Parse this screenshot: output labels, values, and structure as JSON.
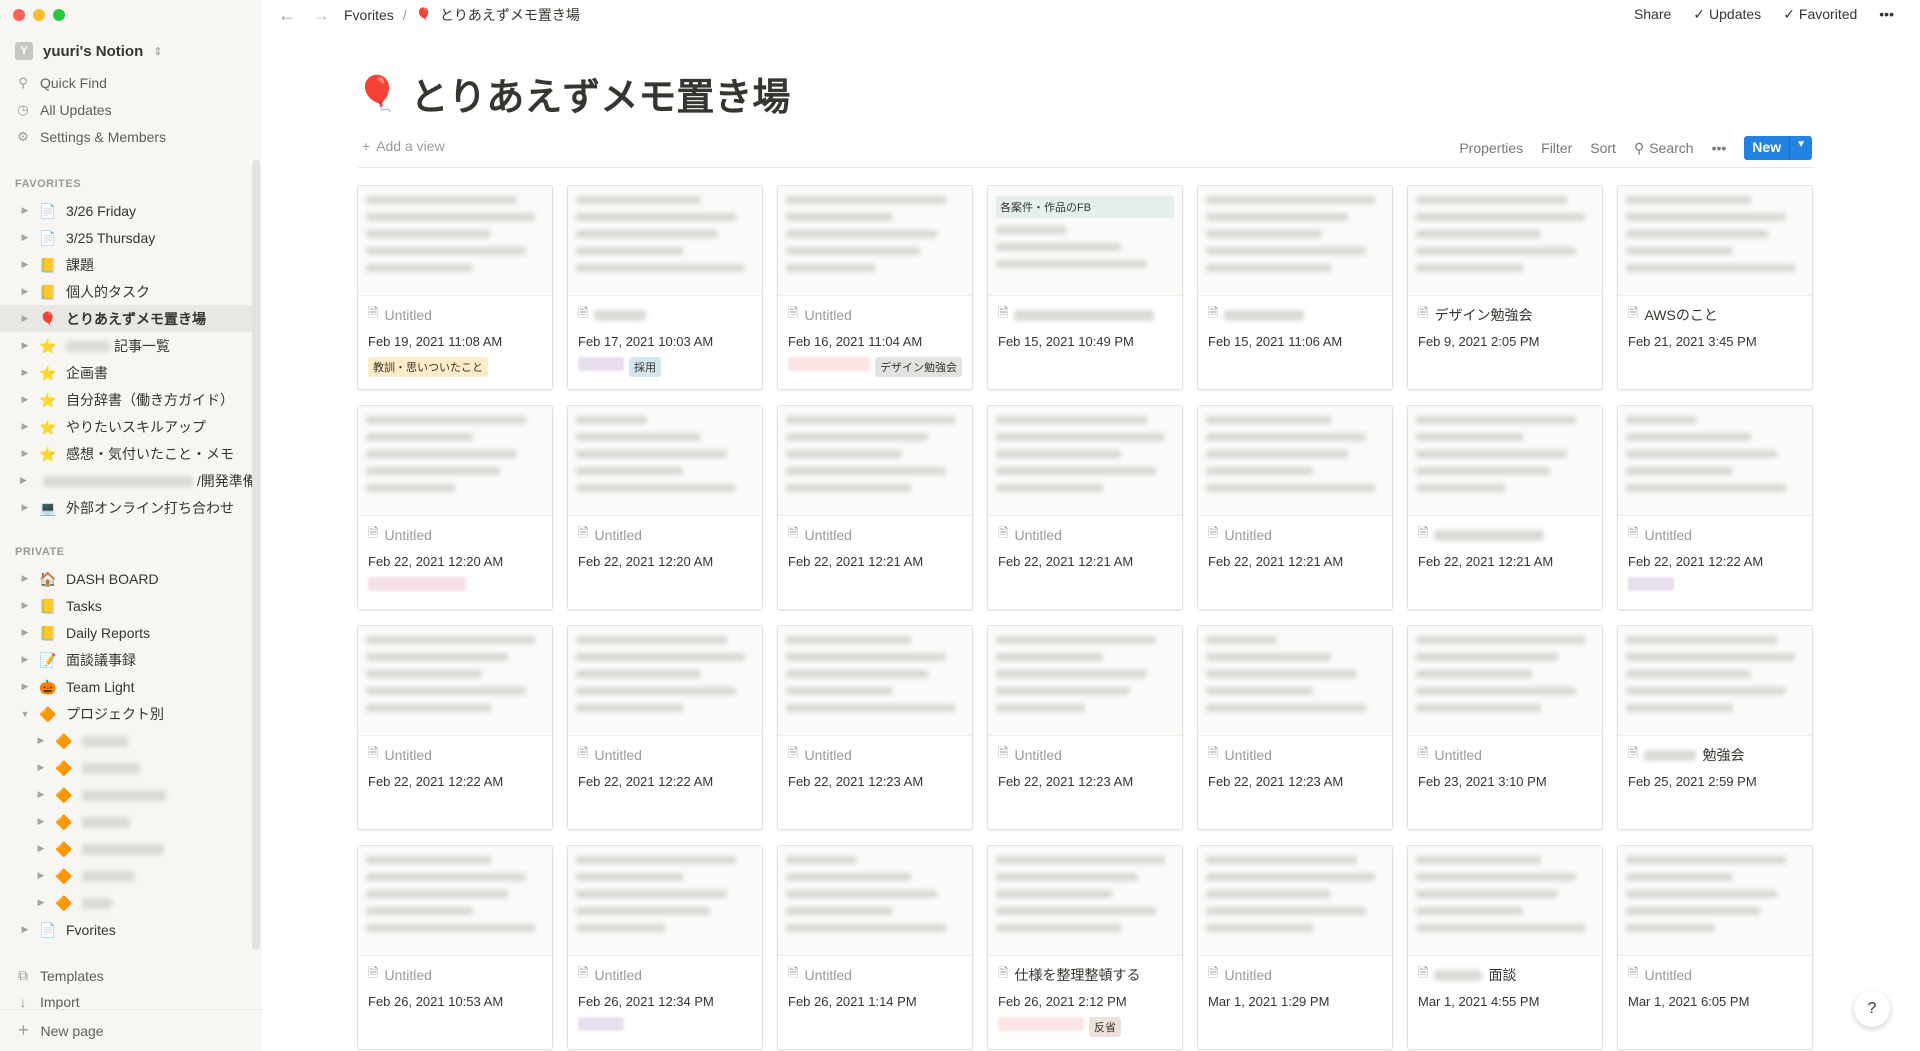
{
  "workspace": {
    "name": "yuuri's Notion",
    "avatar": "Y"
  },
  "nav": {
    "quick_find": "Quick Find",
    "all_updates": "All Updates",
    "settings": "Settings & Members"
  },
  "sidebar": {
    "favorites_label": "FAVORITES",
    "favorites": [
      {
        "icon": "📄",
        "label": "3/26 Friday"
      },
      {
        "icon": "📄",
        "label": "3/25 Thursday"
      },
      {
        "icon": "📒",
        "label": "課題"
      },
      {
        "icon": "📒",
        "label": "個人的タスク"
      },
      {
        "icon": "🎈",
        "label": "とりあえずメモ置き場"
      },
      {
        "icon": "⭐",
        "label": "記事一覧"
      },
      {
        "icon": "⭐",
        "label": "企画書"
      },
      {
        "icon": "⭐",
        "label": "自分辞書（働き方ガイド）"
      },
      {
        "icon": "⭐",
        "label": "やりたいスキルアップ"
      },
      {
        "icon": "⭐",
        "label": "感想・気付いたこと・メモ"
      },
      {
        "icon": "",
        "label": "/開発準備"
      },
      {
        "icon": "💻",
        "label": "外部オンライン打ち合わせ"
      }
    ],
    "private_label": "PRIVATE",
    "private": [
      {
        "icon": "🏠",
        "label": "DASH BOARD"
      },
      {
        "icon": "📒",
        "label": "Tasks"
      },
      {
        "icon": "📒",
        "label": "Daily Reports"
      },
      {
        "icon": "📝",
        "label": "面談議事録"
      },
      {
        "icon": "🎃",
        "label": "Team Light"
      },
      {
        "icon": "🔶",
        "label": "プロジェクト別"
      },
      {
        "icon": "🔶",
        "label": ""
      },
      {
        "icon": "🔶",
        "label": ""
      },
      {
        "icon": "🔶",
        "label": ""
      },
      {
        "icon": "🔶",
        "label": ""
      },
      {
        "icon": "🔶",
        "label": ""
      },
      {
        "icon": "🔶",
        "label": ""
      },
      {
        "icon": "🔶",
        "label": ""
      },
      {
        "icon": "",
        "label": "Fvorites"
      }
    ],
    "templates": "Templates",
    "import": "Import",
    "new_page": "New page"
  },
  "topbar": {
    "breadcrumb": [
      "Fvorites",
      "とりあえずメモ置き場"
    ],
    "breadcrumb_icon": "🎈",
    "share": "Share",
    "updates": "Updates",
    "favorited": "Favorited",
    "more": "•••"
  },
  "page": {
    "icon": "🎈",
    "title": "とりあえずメモ置き場"
  },
  "view": {
    "add_view": "Add a view",
    "properties": "Properties",
    "filter": "Filter",
    "sort": "Sort",
    "search": "Search",
    "more": "•••",
    "new": "New"
  },
  "cards": [
    {
      "title": "Untitled",
      "date": "Feb 19, 2021 11:08 AM",
      "tags": [
        {
          "text": "教訓・思いついたこと",
          "color": "#fdecc8"
        }
      ]
    },
    {
      "title": "",
      "date": "Feb 17, 2021 10:03 AM",
      "tags": [
        {
          "text": "",
          "color": "#e8deee"
        },
        {
          "text": "採用",
          "color": "#d3e5ef"
        }
      ]
    },
    {
      "title": "Untitled",
      "date": "Feb 16, 2021 11:04 AM",
      "tags": [
        {
          "text": "",
          "color": "#fbe4e4"
        },
        {
          "text": "デザイン勉強会",
          "color": "#e3e2e0"
        }
      ]
    },
    {
      "title": "",
      "date": "Feb 15, 2021 10:49 PM",
      "tags": [],
      "preview_header": "各案件・作品のFB"
    },
    {
      "title": "",
      "date": "Feb 15, 2021 11:06 AM",
      "tags": []
    },
    {
      "title": "デザイン勉強会",
      "date": "Feb 9, 2021 2:05 PM",
      "tags": []
    },
    {
      "title": "AWSのこと",
      "date": "Feb 21, 2021 3:45 PM",
      "tags": []
    },
    {
      "title": "Untitled",
      "date": "Feb 22, 2021 12:20 AM",
      "tags": [
        {
          "text": "",
          "color": "#f5e0e9"
        }
      ]
    },
    {
      "title": "Untitled",
      "date": "Feb 22, 2021 12:20 AM",
      "tags": []
    },
    {
      "title": "Untitled",
      "date": "Feb 22, 2021 12:21 AM",
      "tags": []
    },
    {
      "title": "Untitled",
      "date": "Feb 22, 2021 12:21 AM",
      "tags": []
    },
    {
      "title": "Untitled",
      "date": "Feb 22, 2021 12:21 AM",
      "tags": []
    },
    {
      "title": "",
      "date": "Feb 22, 2021 12:21 AM",
      "tags": []
    },
    {
      "title": "Untitled",
      "date": "Feb 22, 2021 12:22 AM",
      "tags": [
        {
          "text": "",
          "color": "#e8deee"
        }
      ]
    },
    {
      "title": "Untitled",
      "date": "Feb 22, 2021 12:22 AM",
      "tags": []
    },
    {
      "title": "Untitled",
      "date": "Feb 22, 2021 12:22 AM",
      "tags": []
    },
    {
      "title": "Untitled",
      "date": "Feb 22, 2021 12:23 AM",
      "tags": []
    },
    {
      "title": "Untitled",
      "date": "Feb 22, 2021 12:23 AM",
      "tags": []
    },
    {
      "title": "Untitled",
      "date": "Feb 22, 2021 12:23 AM",
      "tags": []
    },
    {
      "title": "Untitled",
      "date": "Feb 23, 2021 3:10 PM",
      "tags": []
    },
    {
      "title": "勉強会",
      "date": "Feb 25, 2021 2:59 PM",
      "tags": []
    },
    {
      "title": "Untitled",
      "date": "Feb 26, 2021 10:53 AM",
      "tags": []
    },
    {
      "title": "Untitled",
      "date": "Feb 26, 2021 12:34 PM",
      "tags": [
        {
          "text": "",
          "color": "#e8deee"
        }
      ]
    },
    {
      "title": "Untitled",
      "date": "Feb 26, 2021 1:14 PM",
      "tags": []
    },
    {
      "title": "仕様を整理整頓する",
      "date": "Feb 26, 2021 2:12 PM",
      "tags": [
        {
          "text": "",
          "color": "#fbe4e4"
        },
        {
          "text": "反省",
          "color": "#eee0da"
        }
      ]
    },
    {
      "title": "Untitled",
      "date": "Mar 1, 2021 1:29 PM",
      "tags": []
    },
    {
      "title": "面談",
      "date": "Mar 1, 2021 4:55 PM",
      "tags": []
    },
    {
      "title": "Untitled",
      "date": "Mar 1, 2021 6:05 PM",
      "tags": []
    }
  ],
  "help": "?"
}
